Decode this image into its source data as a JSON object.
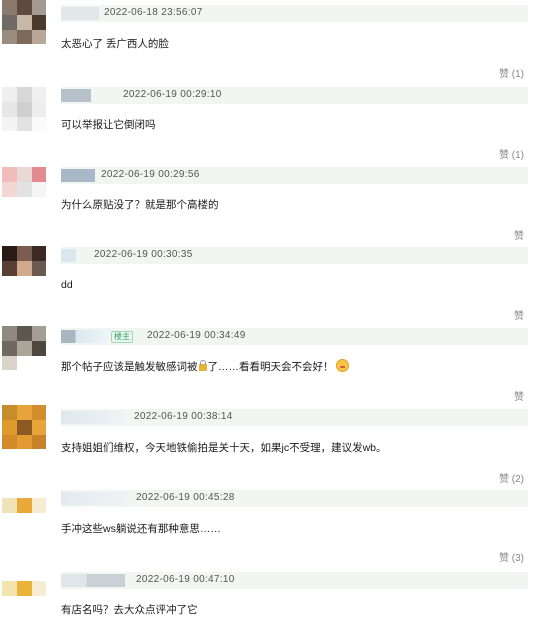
{
  "comments": [
    {
      "timestamp": "2022-06-18 23:56:07",
      "text": "太恶心了 丢广西人的脸",
      "like": "赞 (1)"
    },
    {
      "timestamp": "2022-06-19 00:29:10",
      "text": "可以举报让它倒闭吗",
      "like": "赞 (1)"
    },
    {
      "timestamp": "2022-06-19 00:29:56",
      "text": "为什么原贴没了？就是那个高楼的",
      "like": "赞"
    },
    {
      "timestamp": "2022-06-19 00:30:35",
      "text": "dd",
      "like": "赞"
    },
    {
      "timestamp": "2022-06-19 00:34:49",
      "badge": "楼主",
      "text_before_lock": "那个帖子应该是触发敏感词被",
      "text_after_lock": "了……看看明天会不会好！",
      "like": "赞"
    },
    {
      "timestamp": "2022-06-19 00:38:14",
      "text": "支持姐姐们维权，今天地铁偷拍是关十天，如果jc不受理，建议发wb。",
      "like": "赞 (2)"
    },
    {
      "timestamp": "2022-06-19 00:45:28",
      "text": "手冲这些ws躺说还有那种意思……",
      "like": "赞 (3)"
    },
    {
      "timestamp": "2022-06-19 00:47:10",
      "text": "有店名吗？去大众点评冲了它",
      "like": ""
    }
  ],
  "icons": {
    "lock": "lock-icon",
    "emoji": "grimace-emoji-icon"
  }
}
